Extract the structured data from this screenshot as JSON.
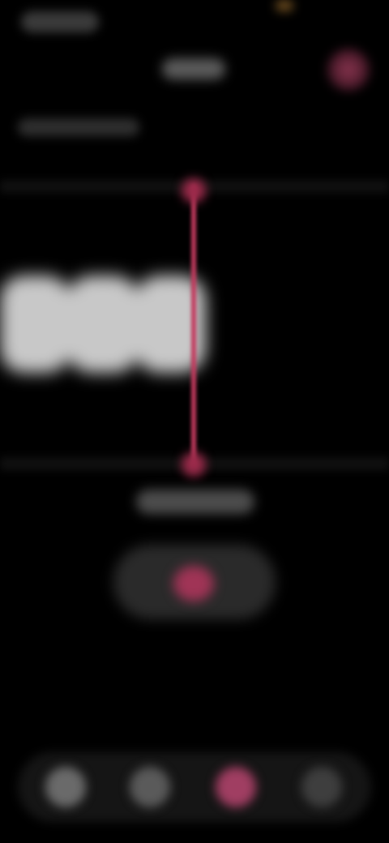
{
  "status_bar": {
    "time": "",
    "indicator_color": "#6a4a1e"
  },
  "header": {
    "title": "",
    "subtitle": "",
    "record_indicator_color": "#8a3550"
  },
  "recorder": {
    "timer": "",
    "accent_color": "#c23a5e",
    "waveform_color": "#c8c8c8",
    "waveform_bars": 3,
    "record_button_icon": "record-icon"
  },
  "bottom_nav": {
    "items": [
      {
        "icon": "nav-icon-1",
        "label": ""
      },
      {
        "icon": "nav-icon-2",
        "label": ""
      },
      {
        "icon": "record-nav-icon",
        "label": "",
        "active": true
      },
      {
        "icon": "nav-icon-4",
        "label": ""
      }
    ]
  }
}
